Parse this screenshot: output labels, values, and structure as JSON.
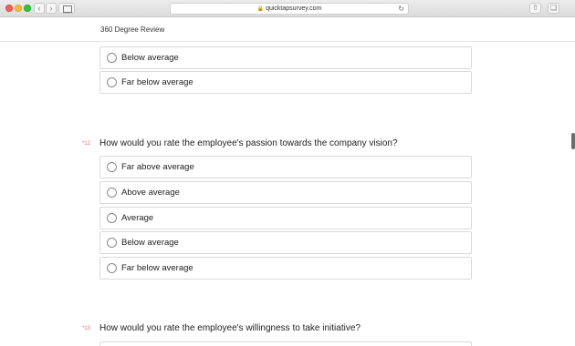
{
  "browser": {
    "url": "quicktapsurvey.com"
  },
  "header": {
    "title": "360 Degree Review"
  },
  "previous_question": {
    "options": [
      "Below average",
      "Far below average"
    ]
  },
  "questions": [
    {
      "number": "*12",
      "text": "How would you rate the employee's passion towards the company vision?",
      "options": [
        "Far above average",
        "Above average",
        "Average",
        "Below average",
        "Far below average"
      ]
    },
    {
      "number": "*13",
      "text": "How would you rate the employee's willingness to take initiative?"
    }
  ]
}
